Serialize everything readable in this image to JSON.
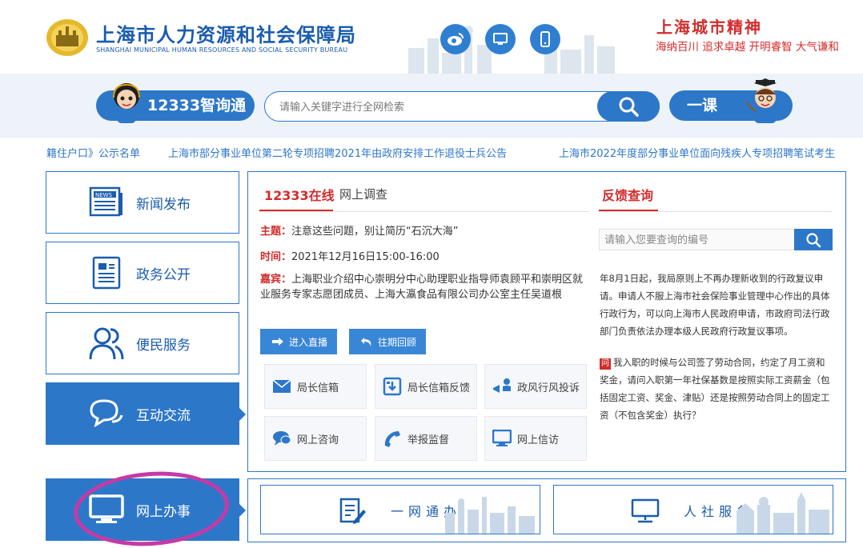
{
  "header": {
    "title_cn": "上海市人力资源和社会保障局",
    "title_en": "SHANGHAI MUNICIPAL HUMAN RESOURCES AND SOCIAL SECURITY BUREAU",
    "icons": [
      "weibo-icon",
      "desktop-icon",
      "mobile-icon"
    ],
    "spirit_title": "上海城市精神",
    "spirit_sub": "海纳百川  追求卓越  开明睿智  大气谦和"
  },
  "search": {
    "hotline_label": "12333智询通",
    "placeholder": "请输入关键字进行全网检索",
    "course_label": "一课"
  },
  "ticker": [
    "籍住户口》公示名单",
    "上海市部分事业单位第二轮专项招聘2021年由政府安排工作退役士兵公告",
    "上海市2022年度部分事业单位面向残疾人专项招聘笔试考生"
  ],
  "nav": [
    {
      "label": "新闻发布",
      "icon": "newspaper-icon"
    },
    {
      "label": "政务公开",
      "icon": "document-icon"
    },
    {
      "label": "便民服务",
      "icon": "users-icon"
    },
    {
      "label": "互动交流",
      "icon": "chat-bubbles-icon"
    },
    {
      "label": "网上办事",
      "icon": "monitor-icon"
    }
  ],
  "online": {
    "tab_active": "12333在线",
    "tab_other": "网上调查",
    "topic_key": "主题：",
    "topic": "注意这些问题，别让简历“石沉大海”",
    "time_key": "时间：",
    "time": "2021年12月16日15:00-16:00",
    "guest_key": "嘉宾：",
    "guest": "上海职业介绍中心崇明分中心助理职业指导师袁顾平和崇明区就业服务专家志愿团成员、上海大瀛食品有限公司办公室主任吴道根",
    "live_btn": "进入直播",
    "replay_btn": "往期回顾"
  },
  "services": [
    {
      "label": "局长信箱",
      "icon": "envelope-icon"
    },
    {
      "label": "局长信箱反馈",
      "icon": "inbox-reply-icon"
    },
    {
      "label": "政风行风投诉",
      "icon": "megaphone-icon"
    },
    {
      "label": "网上咨询",
      "icon": "chat-icon"
    },
    {
      "label": "举报监督",
      "icon": "phone-icon"
    },
    {
      "label": "网上信访",
      "icon": "monitor-icon"
    }
  ],
  "feedback": {
    "title": "反馈查询",
    "placeholder": "请输入您要查询的编号",
    "text1": "年8月1日起，我局原则上不再办理新收到的行政复议申请。申请人不服上海市社会保险事业管理中心作出的具体行政行为，可以向上海市人民政府申请，市政府司法行政部门负责依法办理本级人民政府行政复议事项。",
    "q_badge": "问",
    "text2": "我入职的时候与公司签了劳动合同，约定了月工资和奖金，请问入职第一年社保基数是按照实际工资薪金（包括固定工资、奖金、津贴）还是按照劳动合同上的固定工资（不包含奖金）执行？"
  },
  "banners": {
    "left": "一网通办",
    "right": "人社服务"
  },
  "colors": {
    "brand_blue": "#2d77c9",
    "accent_red": "#d22c2c",
    "annotation": "#c63aa6"
  }
}
